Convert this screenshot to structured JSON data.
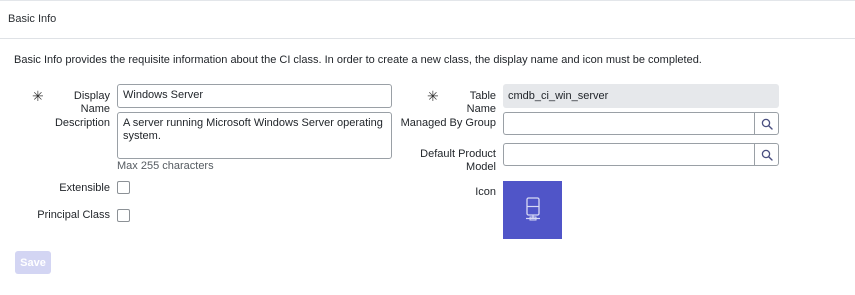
{
  "header": {
    "title": "Basic Info"
  },
  "intro": "Basic Info provides the requisite information about the CI class. In order to create a new class, the display name and icon must be completed.",
  "fields": {
    "display_name": {
      "label": "Display Name",
      "value": "Windows Server"
    },
    "description": {
      "label": "Description",
      "value": "A server running Microsoft Windows Server operating system.",
      "hint": "Max 255 characters"
    },
    "extensible": {
      "label": "Extensible",
      "checked": false
    },
    "principal_class": {
      "label": "Principal Class",
      "checked": false
    },
    "table_name": {
      "label": "Table Name",
      "value": "cmdb_ci_win_server"
    },
    "managed_by_group": {
      "label": "Managed By Group",
      "value": ""
    },
    "default_product_model": {
      "label_line1": "Default Product",
      "label_line2": "Model",
      "value": ""
    },
    "icon": {
      "label": "Icon",
      "icon_name": "server-icon",
      "color": "#5055c8"
    }
  },
  "required_marker": "✳",
  "save_label": "Save",
  "colors": {
    "accent": "#5055c8",
    "save_disabled": "#d3d5f3"
  }
}
